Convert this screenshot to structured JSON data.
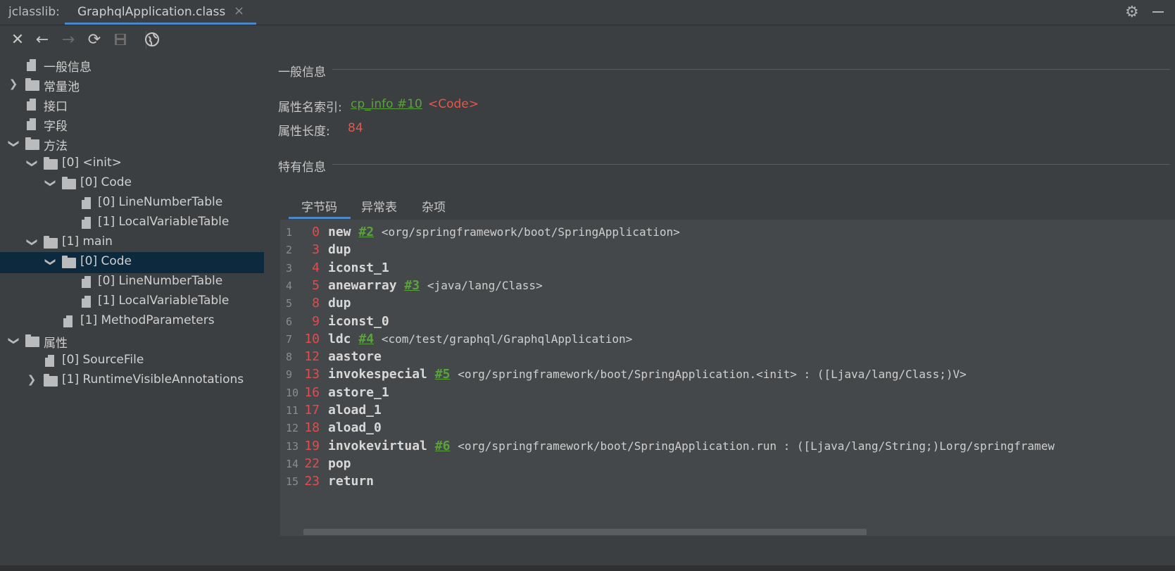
{
  "titlebar": {
    "app_label": "jclasslib:",
    "tab_label": "GraphqlApplication.class",
    "tab_close": "×",
    "settings_icon": "gear-icon",
    "minimize_icon": "minimize-icon"
  },
  "toolbar": {
    "close": "✕",
    "back": "←",
    "forward": "→",
    "refresh": "⟳",
    "save": "💾",
    "browser": "◍"
  },
  "tree": {
    "items": [
      {
        "label": "一般信息"
      },
      {
        "label": "常量池"
      },
      {
        "label": "接口"
      },
      {
        "label": "字段"
      },
      {
        "label": "方法"
      },
      {
        "label": "[0] <init>"
      },
      {
        "label": "[0] Code"
      },
      {
        "label": "[0] LineNumberTable"
      },
      {
        "label": "[1] LocalVariableTable"
      },
      {
        "label": "[1] main"
      },
      {
        "label": "[0] Code"
      },
      {
        "label": "[0] LineNumberTable"
      },
      {
        "label": "[1] LocalVariableTable"
      },
      {
        "label": "[1] MethodParameters"
      },
      {
        "label": "属性"
      },
      {
        "label": "[0] SourceFile"
      },
      {
        "label": "[1] RuntimeVisibleAnnotations"
      }
    ],
    "selected_index": 10
  },
  "detail": {
    "general_title": "一般信息",
    "attr_name_label": "属性名索引:",
    "attr_name_link": "cp_info #10",
    "attr_name_value": "<Code>",
    "attr_length_label": "属性长度:",
    "attr_length_value": "84",
    "specific_title": "特有信息",
    "tabs": [
      "字节码",
      "异常表",
      "杂项"
    ],
    "active_tab": "字节码"
  },
  "bytecode": [
    {
      "line": "1",
      "offset": "0",
      "instr": "new",
      "ref": "#2",
      "comment": "<org/springframework/boot/SpringApplication>"
    },
    {
      "line": "2",
      "offset": "3",
      "instr": "dup",
      "ref": "",
      "comment": ""
    },
    {
      "line": "3",
      "offset": "4",
      "instr": "iconst_1",
      "ref": "",
      "comment": ""
    },
    {
      "line": "4",
      "offset": "5",
      "instr": "anewarray",
      "ref": "#3",
      "comment": "<java/lang/Class>"
    },
    {
      "line": "5",
      "offset": "8",
      "instr": "dup",
      "ref": "",
      "comment": ""
    },
    {
      "line": "6",
      "offset": "9",
      "instr": "iconst_0",
      "ref": "",
      "comment": ""
    },
    {
      "line": "7",
      "offset": "10",
      "instr": "ldc",
      "ref": "#4",
      "comment": "<com/test/graphql/GraphqlApplication>"
    },
    {
      "line": "8",
      "offset": "12",
      "instr": "aastore",
      "ref": "",
      "comment": ""
    },
    {
      "line": "9",
      "offset": "13",
      "instr": "invokespecial",
      "ref": "#5",
      "comment": "<org/springframework/boot/SpringApplication.<init> : ([Ljava/lang/Class;)V>"
    },
    {
      "line": "10",
      "offset": "16",
      "instr": "astore_1",
      "ref": "",
      "comment": ""
    },
    {
      "line": "11",
      "offset": "17",
      "instr": "aload_1",
      "ref": "",
      "comment": ""
    },
    {
      "line": "12",
      "offset": "18",
      "instr": "aload_0",
      "ref": "",
      "comment": ""
    },
    {
      "line": "13",
      "offset": "19",
      "instr": "invokevirtual",
      "ref": "#6",
      "comment": "<org/springframework/boot/SpringApplication.run : ([Ljava/lang/String;)Lorg/springframew"
    },
    {
      "line": "14",
      "offset": "22",
      "instr": "pop",
      "ref": "",
      "comment": ""
    },
    {
      "line": "15",
      "offset": "23",
      "instr": "return",
      "ref": "",
      "comment": ""
    }
  ],
  "colors": {
    "background": "#3c3f41",
    "code_background": "#45484a",
    "selection": "#0d293e",
    "accent": "#4a88c7",
    "link_green": "#5aa33c",
    "value_red": "#e05a4e"
  }
}
